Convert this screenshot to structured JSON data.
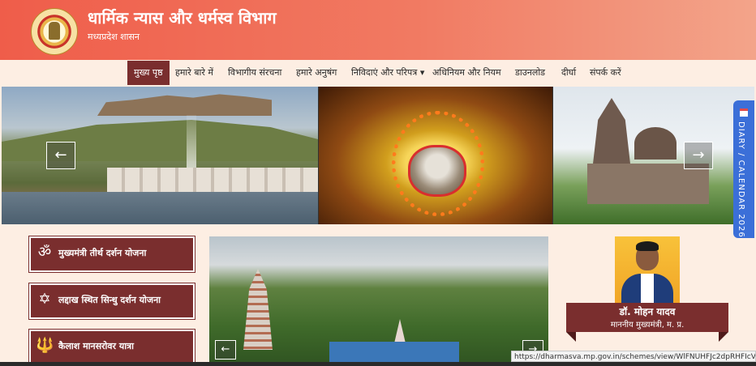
{
  "header": {
    "title": "धार्मिक न्यास और धर्मस्व विभाग",
    "subtitle": "मध्यप्रदेश शासन"
  },
  "nav": {
    "items": [
      {
        "label": "मुख्य पृष्ठ",
        "active": true
      },
      {
        "label": "हमारे बारे में"
      },
      {
        "label": "विभागीय संरचना"
      },
      {
        "label": "हमारे अनुषंग"
      },
      {
        "label": "निविदाएं और परिपत्र ▾"
      },
      {
        "label": "अधिनियम और नियम"
      },
      {
        "label": "डाउनलोड"
      },
      {
        "label": "दीर्घा"
      },
      {
        "label": "संपर्क करें"
      }
    ]
  },
  "slider": {
    "prev_icon": "arrow-left-icon",
    "next_icon": "arrow-right-icon",
    "prev_symbol": "←",
    "next_symbol": "→"
  },
  "diary_tab": {
    "label": "DIARY / CALENDAR 2026"
  },
  "schemes": [
    {
      "label": "मुख्यमंत्री तीर्थ दर्शन योजना",
      "icon": "om-icon",
      "symbol": "ॐ"
    },
    {
      "label": "लद्दाख स्थित सिन्धु दर्शन योजना",
      "icon": "star-of-david-icon",
      "symbol": "✡"
    },
    {
      "label": "कैलाश मानसरोवर यात्रा",
      "icon": "trident-icon",
      "symbol": "🔱"
    }
  ],
  "cm": {
    "name": "डॉ. मोहन यादव",
    "role": "माननीय मुख्यमंत्री, म. प्र."
  },
  "status_bar": {
    "url": "https://dharmasva.mp.gov.in/schemes/view/WlFNUHFJc2dpRHFIcVl1RlEyb3Q1UT"
  },
  "colors": {
    "header_start": "#ef5d4a",
    "nav_active": "#7a2e2e",
    "diary_blue": "#3b6fd8"
  }
}
